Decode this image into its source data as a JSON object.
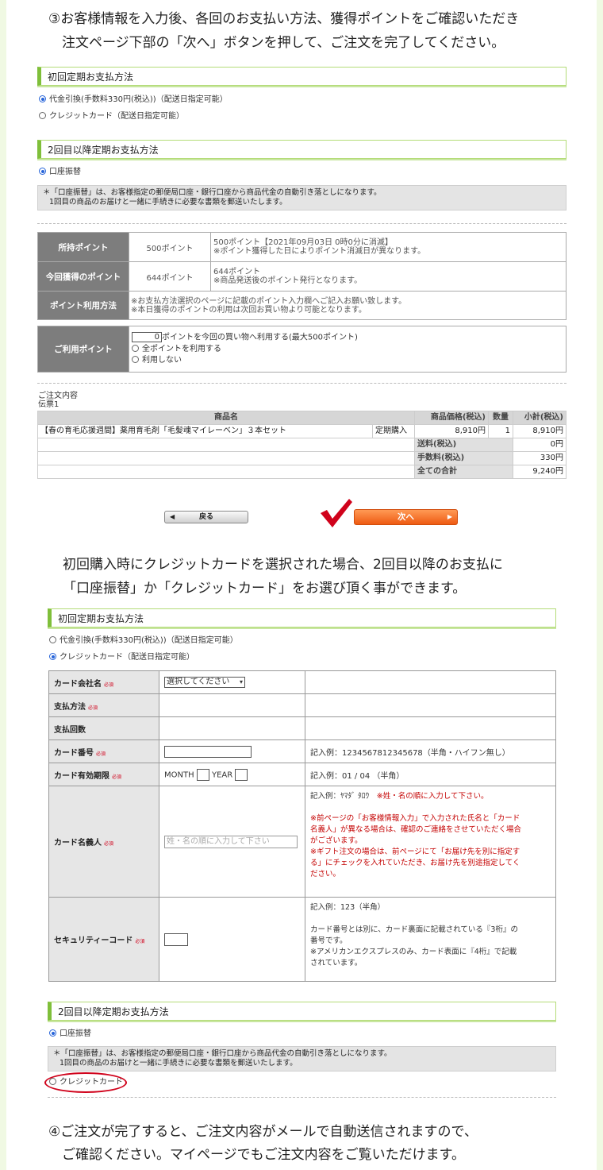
{
  "intro": {
    "line1": "③お客様情報を入力後、各回のお支払い方法、獲得ポイントをご確認いただき",
    "line2": "注文ページ下部の「次へ」ボタンを押して、ご注文を完了してください。"
  },
  "first_payment": {
    "title": "初回定期お支払方法",
    "options": [
      "代金引換(手数料330円(税込))（配送日指定可能）",
      "クレジットカード（配送日指定可能）"
    ],
    "selected": 0
  },
  "second_payment": {
    "title": "2回目以降定期お支払方法",
    "option": "口座振替",
    "note1": "＊「口座振替」は、お客様指定の郵便局口座・銀行口座から商品代金の自動引き落としになります。",
    "note2": "1回目の商品のお届けと一緒に手続きに必要な書類を郵送いたします。"
  },
  "points": {
    "rows": [
      {
        "label": "所持ポイント",
        "value": "500ポイント",
        "desc1": "500ポイント【2021年09月03日 0時0分に消滅】",
        "desc2": "※ポイント獲得した日によりポイント消滅日が異なります。"
      },
      {
        "label": "今回獲得のポイント",
        "value": "644ポイント",
        "desc1": "644ポイント",
        "desc2": "※商品発送後のポイント発行となります。"
      },
      {
        "label": "ポイント利用方法",
        "desc1": "※お支払方法選択のページに記載のポイント入力欄へご記入お願い致します。",
        "desc2": "※本日獲得のポイントの利用は次回お買い物より可能となります。"
      }
    ],
    "use_label": "ご利用ポイント",
    "use_value": "0",
    "use_text": "ポイントを今回の買い物へ利用する(最大500ポイント)",
    "use_all": "全ポイントを利用する",
    "use_none": "利用しない"
  },
  "order": {
    "heading": "ご注文内容",
    "slip": "伝票1",
    "col_product": "商品名",
    "col_price": "商品価格(税込)",
    "col_qty": "数量",
    "col_sub": "小計(税込)",
    "item_name": "【春の育毛応援週間】薬用育毛剤「毛髪魂マイレーベン」３本セット",
    "item_type": "定期購入",
    "item_price": "8,910円",
    "item_qty": "1",
    "item_sub": "8,910円",
    "shipping_label": "送料(税込)",
    "shipping": "0円",
    "fee_label": "手数料(税込)",
    "fee": "330円",
    "total_label": "全ての合計",
    "total": "9,240円"
  },
  "buttons": {
    "back": "戻る",
    "next": "次へ"
  },
  "mid_text": {
    "line1": "初回購入時にクレジットカードを選択された場合、2回目以降のお支払に",
    "line2": "「口座振替」か「クレジットカード」をお選び頂く事ができます。"
  },
  "card_form": {
    "required": "必須",
    "company_label": "カード会社名",
    "company_select": "選択してください",
    "method_label": "支払方法",
    "count_label": "支払回数",
    "number_label": "カード番号",
    "number_example": "記入例：1234567812345678（半角・ハイフン無し）",
    "expiry_label": "カード有効期限",
    "month": "MONTH",
    "year": "YEAR",
    "expiry_example": "記入例：01 / 04 （半角）",
    "holder_label": "カード名義人",
    "holder_placeholder": "姓・名の順に入力して下さい",
    "holder_example": "記入例：ﾔﾏﾀﾞ ﾀﾛｳ",
    "holder_warn": "※姓・名の順に入力して下さい。",
    "holder_note1": "※前ページの「お客様情報入力」で入力された氏名と「カード",
    "holder_note2": "名義人」が異なる場合は、確認のご連絡をさせていただく場合",
    "holder_note3": "がございます。",
    "holder_note4": "※ギフト注文の場合は、前ページにて「お届け先を別に指定す",
    "holder_note5": "る」にチェックを入れていただき、お届け先を別途指定してく",
    "holder_note6": "ださい。",
    "sec_label": "セキュリティーコード",
    "sec_example": "記入例：123（半角）",
    "sec_note1": "カード番号とは別に、カード裏面に記載されている『3桁』の",
    "sec_note2": "番号です。",
    "sec_note3": "※アメリカンエクスプレスのみ、カード表面に『4桁』で記載",
    "sec_note4": "されています。"
  },
  "second_payment_b": {
    "option1": "口座振替",
    "option2": "クレジットカード"
  },
  "final_text": {
    "line1": "④ご注文が完了すると、ご注文内容がメールで自動送信されますので、",
    "line2": "ご確認ください。マイページでもご注文内容をご覧いただけます。"
  },
  "colors": {
    "accent_green": "#7fbf3a",
    "next_orange": "#ee5a12",
    "check_red": "#d0021b"
  }
}
